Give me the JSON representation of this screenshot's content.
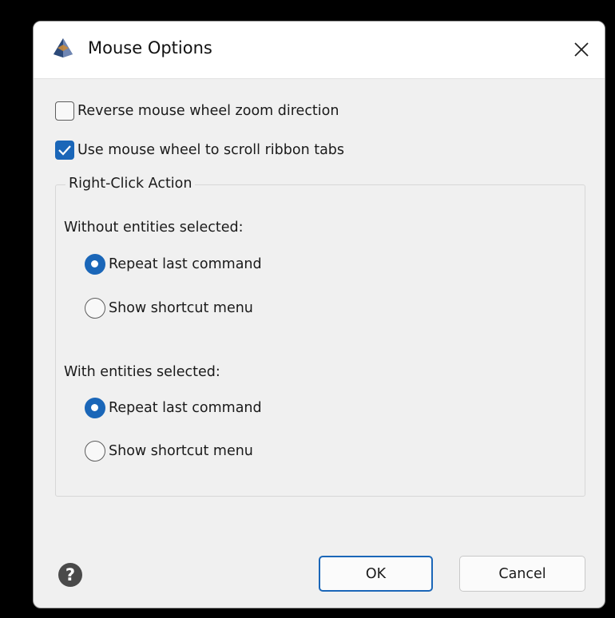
{
  "window": {
    "title": "Mouse Options"
  },
  "options": {
    "reverse_zoom": {
      "label": "Reverse mouse wheel zoom direction",
      "checked": false
    },
    "scroll_ribbon": {
      "label": "Use mouse wheel to scroll ribbon tabs",
      "checked": true
    }
  },
  "right_click": {
    "legend": "Right-Click Action",
    "without_selection": {
      "heading": "Without entities selected:",
      "options": [
        {
          "label": "Repeat last command",
          "selected": true
        },
        {
          "label": "Show shortcut menu",
          "selected": false
        }
      ]
    },
    "with_selection": {
      "heading": "With entities selected:",
      "options": [
        {
          "label": "Repeat last command",
          "selected": true
        },
        {
          "label": "Show shortcut menu",
          "selected": false
        }
      ]
    }
  },
  "footer": {
    "help_symbol": "?",
    "ok_label": "OK",
    "cancel_label": "Cancel"
  },
  "icons": {
    "app": "app-logo-icon",
    "close": "close-icon",
    "help": "help-icon"
  },
  "colors": {
    "accent": "#1a66b8",
    "dialog_bg": "#f0f0f0",
    "titlebar_bg": "#ffffff"
  }
}
